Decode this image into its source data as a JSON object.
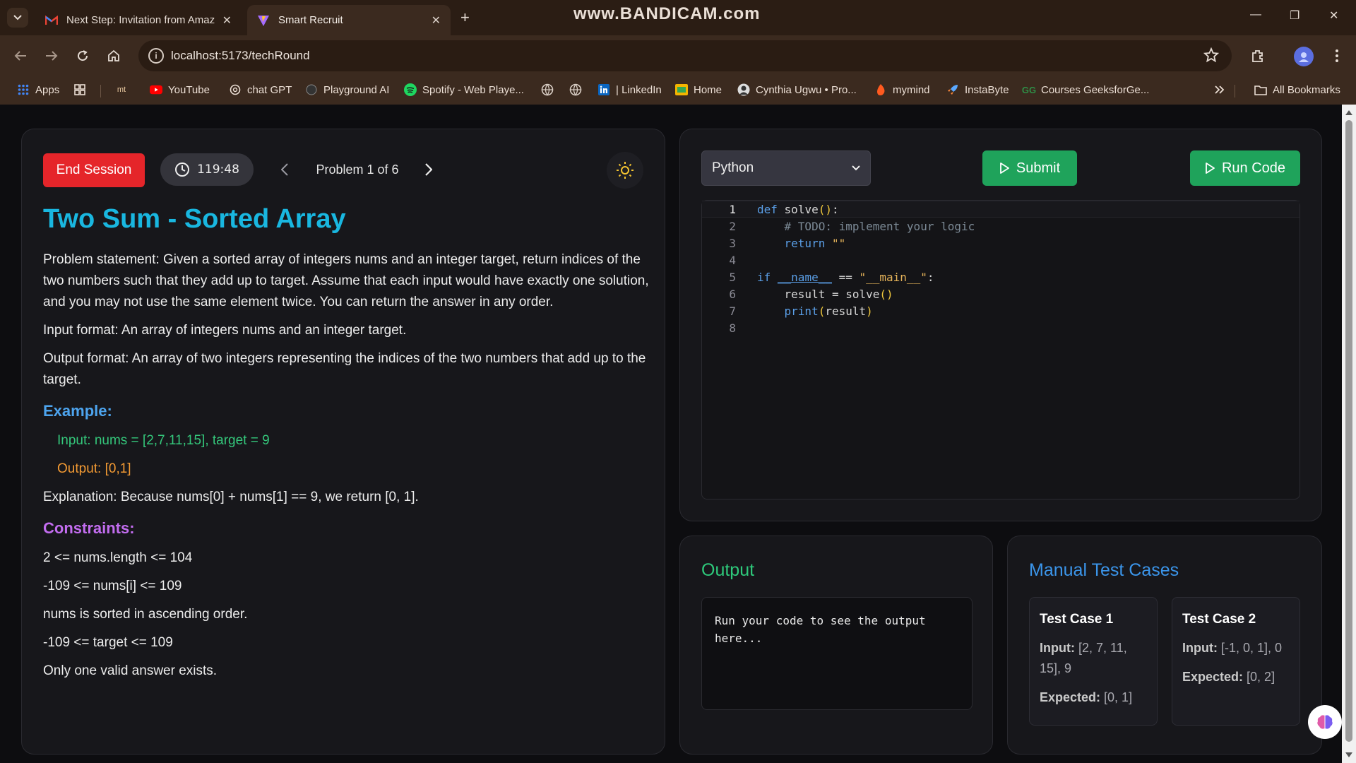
{
  "browser": {
    "tabs": [
      {
        "title": "Next Step: Invitation from Amaz",
        "favicon": "gmail-icon",
        "active": false
      },
      {
        "title": "Smart Recruit",
        "favicon": "vite-icon",
        "active": true
      }
    ],
    "watermark": "www.BANDICAM.com",
    "url": "localhost:5173/techRound",
    "bookmarks": [
      {
        "label": "Apps"
      },
      {
        "label": ""
      },
      {
        "label": ""
      },
      {
        "label": "YouTube"
      },
      {
        "label": "chat GPT"
      },
      {
        "label": "Playground AI"
      },
      {
        "label": "Spotify - Web Playe..."
      },
      {
        "label": ""
      },
      {
        "label": ""
      },
      {
        "label": "| LinkedIn"
      },
      {
        "label": "Home"
      },
      {
        "label": "Cynthia Ugwu • Pro..."
      },
      {
        "label": "mymind"
      },
      {
        "label": "InstaByte"
      },
      {
        "label": "Courses GeeksforGe..."
      }
    ],
    "all_bookmarks": "All Bookmarks",
    "bookmark_mt": "mt"
  },
  "problem": {
    "end_session": "End Session",
    "timer": "119:48",
    "nav_label": "Problem 1 of 6",
    "title": "Two Sum - Sorted Array",
    "statement": "Problem statement: Given a sorted array of integers nums and an integer target, return indices of the two numbers such that they add up to target. Assume that each input would have exactly one solution, and you may not use the same element twice. You can return the answer in any order.",
    "input_format": "Input format: An array of integers nums and an integer target.",
    "output_format": "Output format: An array of two integers representing the indices of the two numbers that add up to the target.",
    "example_heading": "Example:",
    "example_input": "Input: nums = [2,7,11,15], target = 9",
    "example_output": "Output: [0,1]",
    "explanation": "Explanation: Because nums[0] + nums[1] == 9, we return [0, 1].",
    "constraints_heading": "Constraints:",
    "constraints": [
      "2 <= nums.length <= 104",
      "-109 <= nums[i] <= 109",
      "nums is sorted in ascending order.",
      "-109 <= target <= 109",
      "Only one valid answer exists."
    ]
  },
  "editor": {
    "language": "Python",
    "submit": "Submit",
    "run": "Run Code",
    "line_numbers": [
      "1",
      "2",
      "3",
      "4",
      "5",
      "6",
      "7",
      "8"
    ]
  },
  "output": {
    "title": "Output",
    "placeholder": "Run your code to see the output here..."
  },
  "manual_tests": {
    "title": "Manual Test Cases",
    "cases": [
      {
        "name": "Test Case 1",
        "input_label": "Input:",
        "input": "[2, 7, 11, 15], 9",
        "expected_label": "Expected:",
        "expected": "[0, 1]"
      },
      {
        "name": "Test Case 2",
        "input_label": "Input:",
        "input": "[-1, 0, 1], 0",
        "expected_label": "Expected:",
        "expected": "[0, 2]"
      }
    ]
  },
  "colors": {
    "accent_title": "#19b7e0",
    "end_session": "#e5252a",
    "run_green": "#1fa35b",
    "example_input": "#34c77b",
    "example_output": "#f39a33",
    "constraints": "#c36df0"
  }
}
